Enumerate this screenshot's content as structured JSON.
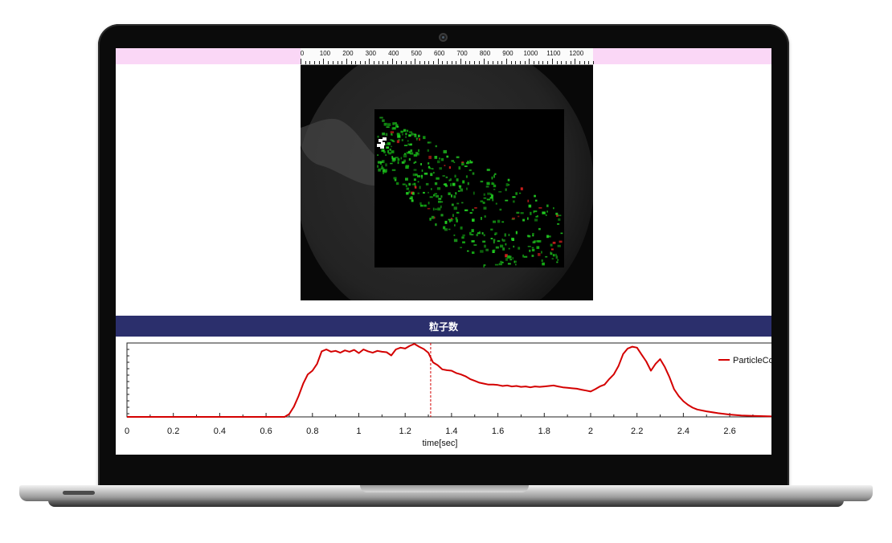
{
  "ruler": {
    "labels": [
      "0",
      "100",
      "200",
      "300",
      "400",
      "500",
      "600",
      "700",
      "800",
      "900",
      "1000",
      "1100",
      "1200"
    ],
    "max": 1280
  },
  "panel": {
    "title": "粒子数"
  },
  "chart_data": {
    "type": "line",
    "title": "粒子数",
    "xlabel": "time[sec]",
    "ylabel": "",
    "xlim": [
      0,
      2.78
    ],
    "xticks": [
      0,
      0.2,
      0.4,
      0.6,
      0.8,
      1,
      1.2,
      1.4,
      1.6,
      1.8,
      2,
      2.2,
      2.4,
      2.6
    ],
    "xtick_labels": [
      "0",
      "0.2",
      "0.4",
      "0.6",
      "0.8",
      "1",
      "1.2",
      "1.4",
      "1.6",
      "1.8",
      "2",
      "2.2",
      "2.4",
      "2.6"
    ],
    "ylim": [
      0,
      160
    ],
    "cursor_time": 1.31,
    "legend_position": "top-right",
    "series": [
      {
        "name": "ParticleCo",
        "color": "#d40000",
        "x": [
          0,
          0.68,
          0.7,
          0.72,
          0.74,
          0.76,
          0.78,
          0.8,
          0.82,
          0.84,
          0.86,
          0.88,
          0.9,
          0.92,
          0.94,
          0.96,
          0.98,
          1.0,
          1.02,
          1.04,
          1.06,
          1.08,
          1.1,
          1.12,
          1.14,
          1.16,
          1.18,
          1.2,
          1.22,
          1.24,
          1.26,
          1.28,
          1.3,
          1.32,
          1.34,
          1.36,
          1.38,
          1.4,
          1.42,
          1.44,
          1.46,
          1.48,
          1.5,
          1.52,
          1.54,
          1.56,
          1.58,
          1.6,
          1.62,
          1.64,
          1.66,
          1.68,
          1.7,
          1.72,
          1.74,
          1.76,
          1.78,
          1.8,
          1.82,
          1.84,
          1.86,
          1.88,
          1.9,
          1.92,
          1.94,
          1.96,
          1.98,
          2.0,
          2.02,
          2.04,
          2.06,
          2.08,
          2.1,
          2.12,
          2.14,
          2.16,
          2.18,
          2.2,
          2.22,
          2.24,
          2.26,
          2.28,
          2.3,
          2.32,
          2.34,
          2.36,
          2.38,
          2.4,
          2.42,
          2.44,
          2.46,
          2.5,
          2.55,
          2.6,
          2.65,
          2.7,
          2.78
        ],
        "y": [
          0,
          0,
          6,
          22,
          45,
          72,
          92,
          100,
          115,
          142,
          146,
          141,
          143,
          139,
          144,
          141,
          145,
          138,
          146,
          142,
          139,
          143,
          141,
          140,
          133,
          146,
          150,
          148,
          154,
          158,
          152,
          147,
          139,
          118,
          112,
          103,
          101,
          100,
          95,
          92,
          88,
          82,
          78,
          74,
          72,
          70,
          70,
          69,
          67,
          68,
          66,
          67,
          65,
          66,
          64,
          66,
          65,
          66,
          67,
          68,
          66,
          64,
          63,
          62,
          61,
          59,
          57,
          55,
          60,
          66,
          70,
          82,
          92,
          110,
          136,
          148,
          152,
          150,
          135,
          120,
          100,
          115,
          125,
          108,
          86,
          60,
          45,
          34,
          26,
          20,
          16,
          12,
          8,
          5,
          3,
          2,
          1
        ]
      }
    ]
  }
}
